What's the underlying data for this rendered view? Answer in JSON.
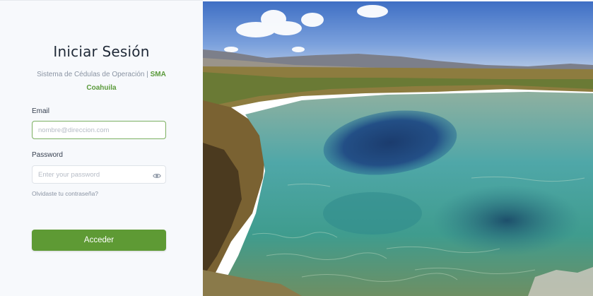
{
  "login": {
    "title": "Iniciar Sesión",
    "subtitle_prefix": "Sistema de Cédulas de Operación | ",
    "subtitle_brand_1": "SMA",
    "subtitle_brand_2": "Coahuila",
    "email_label": "Email",
    "email_placeholder": "nombre@direccion.com",
    "password_label": "Password",
    "password_placeholder": "Enter your password",
    "forgot_link": "Olvidaste tu contraseña?",
    "submit_label": "Acceder"
  },
  "icons": {
    "password_toggle": "eye-icon"
  },
  "colors": {
    "accent": "#5e9a34",
    "brand_text": "#5a9a3a",
    "panel_bg": "#f7f9fc"
  },
  "hero_image": {
    "description_name": "landscape-photo"
  }
}
